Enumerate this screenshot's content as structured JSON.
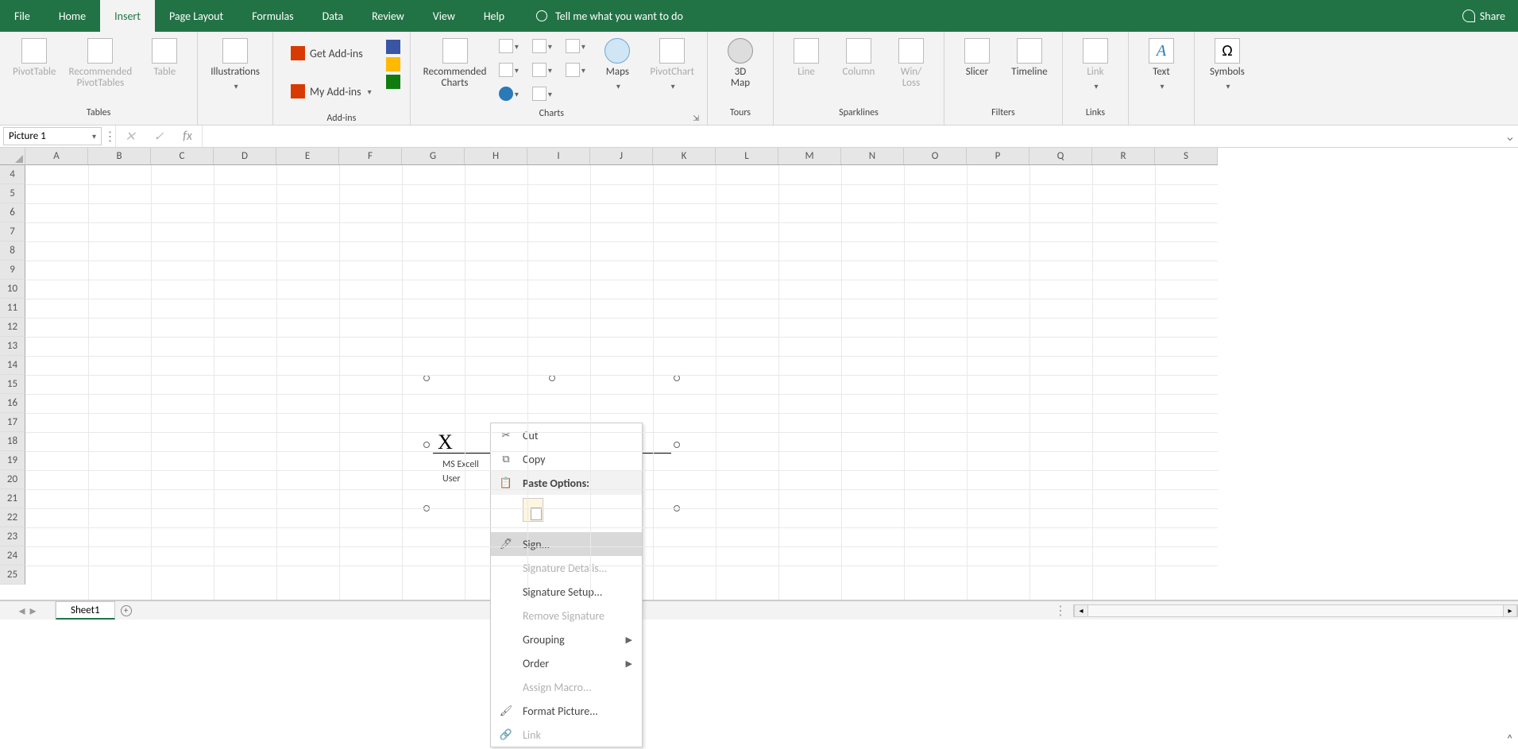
{
  "menu": {
    "items": [
      "File",
      "Home",
      "Insert",
      "Page Layout",
      "Formulas",
      "Data",
      "Review",
      "View",
      "Help"
    ],
    "active_index": 2,
    "tellme": "Tell me what you want to do",
    "share": "Share"
  },
  "ribbon": {
    "groups": {
      "tables": {
        "label": "Tables",
        "pivottable": "PivotTable",
        "recommended_pivottables": "Recommended\nPivotTables",
        "table": "Table"
      },
      "illustrations": {
        "label": "Illustrations"
      },
      "addins": {
        "label": "Add-ins",
        "get": "Get Add-ins",
        "my": "My Add-ins"
      },
      "charts": {
        "label": "Charts",
        "recommended": "Recommended\nCharts",
        "maps": "Maps",
        "pivotchart": "PivotChart"
      },
      "tours": {
        "label": "Tours",
        "map3d": "3D\nMap"
      },
      "sparklines": {
        "label": "Sparklines",
        "line": "Line",
        "column": "Column",
        "winloss": "Win/\nLoss"
      },
      "filters": {
        "label": "Filters",
        "slicer": "Slicer",
        "timeline": "Timeline"
      },
      "links": {
        "label": "Links",
        "link": "Link"
      },
      "text": {
        "label": "Text"
      },
      "symbols": {
        "label": "Symbols"
      }
    }
  },
  "namebox": "Picture 1",
  "fx_value": "",
  "columns": [
    "A",
    "B",
    "C",
    "D",
    "E",
    "F",
    "G",
    "H",
    "I",
    "J",
    "K",
    "L",
    "M",
    "N",
    "O",
    "P",
    "Q",
    "R",
    "S"
  ],
  "rows": [
    4,
    5,
    6,
    7,
    8,
    9,
    10,
    11,
    12,
    13,
    14,
    15,
    16,
    17,
    18,
    19,
    20,
    21,
    22,
    23,
    24,
    25
  ],
  "signature": {
    "x": "X",
    "name": "MS Excell",
    "role": "User"
  },
  "context_menu": {
    "cut": "Cut",
    "copy": "Copy",
    "paste_options": "Paste Options:",
    "sign": "Sign...",
    "signature_details": "Signature Details...",
    "signature_setup": "Signature Setup...",
    "remove_signature": "Remove Signature",
    "grouping": "Grouping",
    "order": "Order",
    "assign_macro": "Assign Macro...",
    "format_picture": "Format Picture...",
    "link": "Link"
  },
  "tabs": {
    "sheet1": "Sheet1"
  }
}
